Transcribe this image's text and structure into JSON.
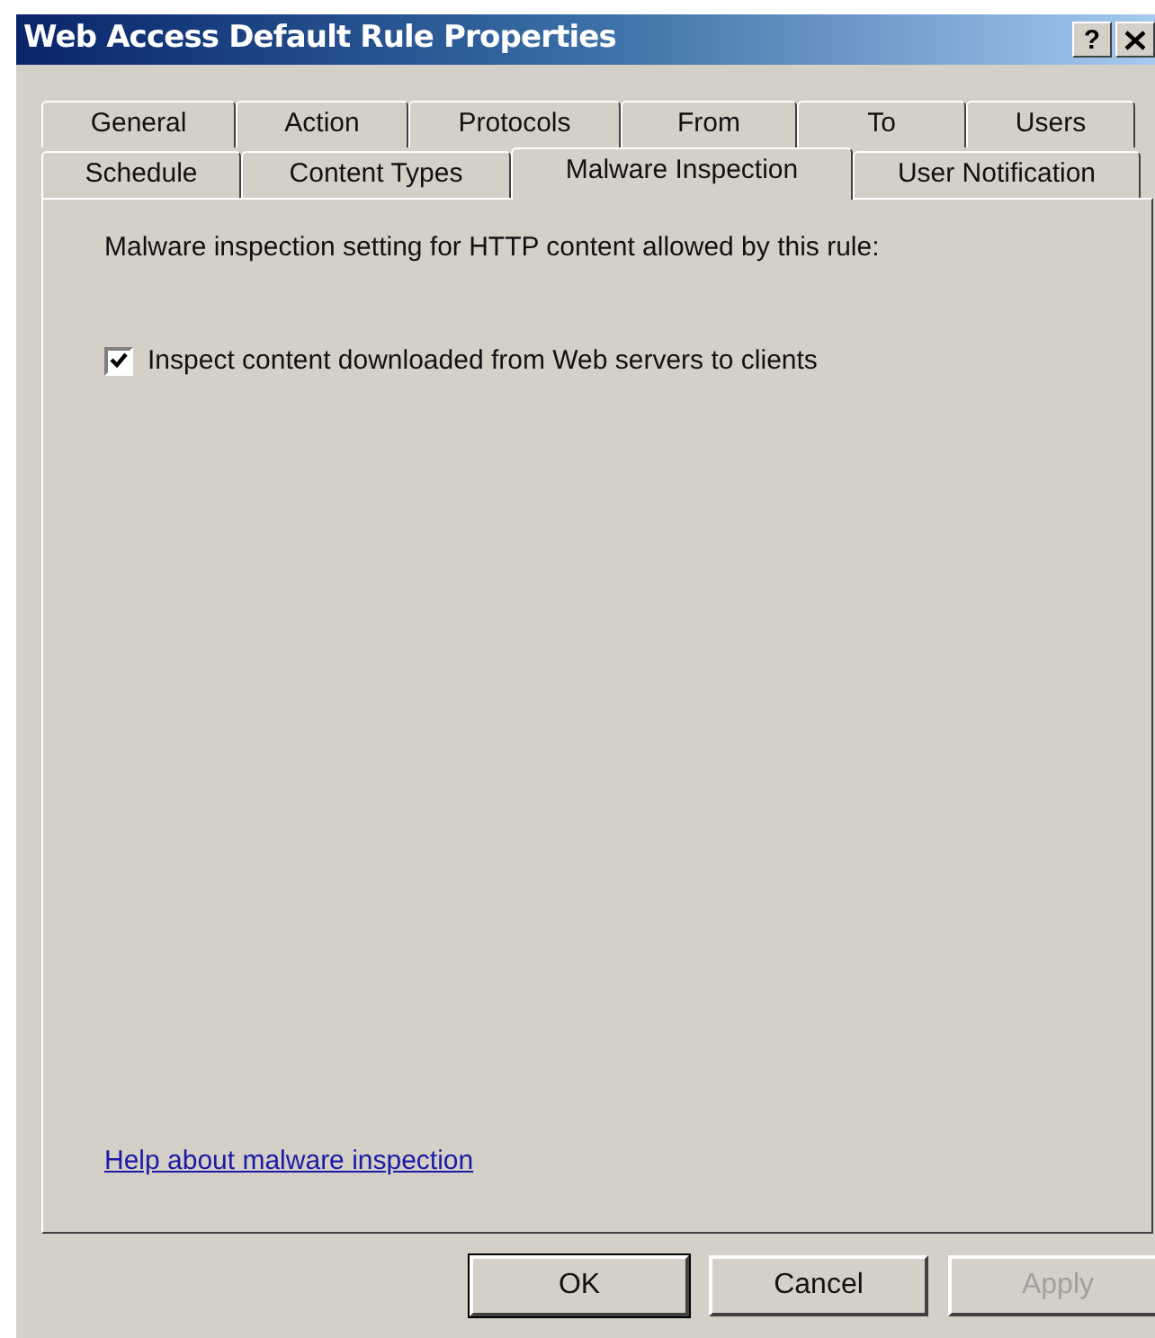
{
  "window": {
    "title": "Web Access Default Rule Properties",
    "help_button": "?"
  },
  "tab_rows": [
    [
      {
        "label": "General",
        "selected": false
      },
      {
        "label": "Action",
        "selected": false
      },
      {
        "label": "Protocols",
        "selected": false
      },
      {
        "label": "From",
        "selected": false
      },
      {
        "label": "To",
        "selected": false
      },
      {
        "label": "Users",
        "selected": false
      }
    ],
    [
      {
        "label": "Schedule",
        "selected": false
      },
      {
        "label": "Content Types",
        "selected": false
      },
      {
        "label": "Malware Inspection",
        "selected": true
      },
      {
        "label": "User Notification",
        "selected": false
      }
    ]
  ],
  "description": "Malware inspection setting for HTTP content allowed by this rule:",
  "checkbox": {
    "label": "Inspect content downloaded from Web servers to clients",
    "checked": true
  },
  "help_link": "Help about malware inspection",
  "buttons": [
    {
      "label": "OK",
      "disabled": false,
      "default": true
    },
    {
      "label": "Cancel",
      "disabled": false,
      "default": false
    },
    {
      "label": "Apply",
      "disabled": true,
      "default": false
    }
  ]
}
